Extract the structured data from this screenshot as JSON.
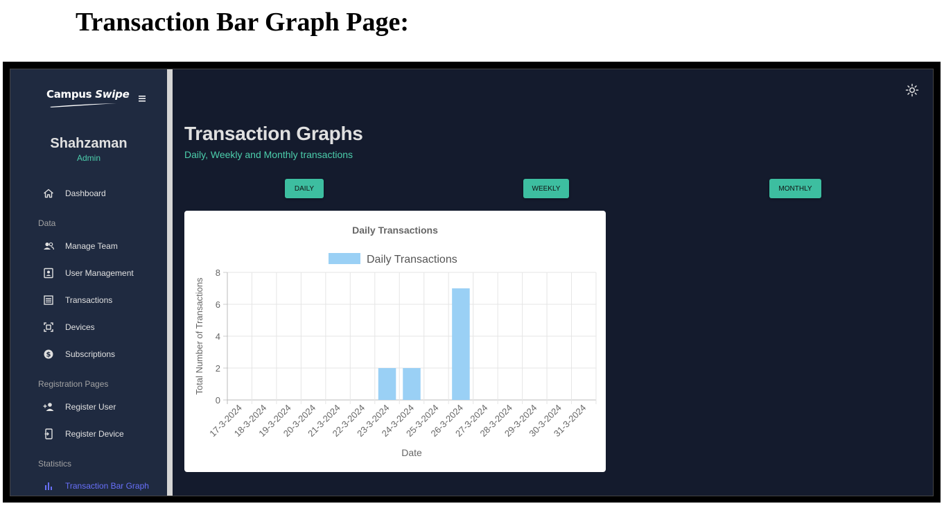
{
  "page": {
    "heading": "Transaction Bar Graph Page:"
  },
  "app": {
    "logo": {
      "text1": "Campus ",
      "text2": "Swipe"
    },
    "profile": {
      "name": "Shahzaman",
      "role": "Admin"
    },
    "sidebar": {
      "dashboard": "Dashboard",
      "sections": [
        {
          "title": "Data",
          "items": [
            "Manage Team",
            "User Management",
            "Transactions",
            "Devices",
            "Subscriptions"
          ]
        },
        {
          "title": "Registration Pages",
          "items": [
            "Register User",
            "Register Device"
          ]
        },
        {
          "title": "Statistics",
          "items": [
            "Transaction Bar Graph"
          ]
        }
      ]
    },
    "main": {
      "title": "Transaction Graphs",
      "subtitle": "Daily, Weekly and Monthly transactions",
      "buttons": {
        "daily": "DAILY",
        "weekly": "WEEKLY",
        "monthly": "MONTHLY"
      }
    },
    "colors": {
      "accent": "#4cceac",
      "active": "#6870fa",
      "bar": "#9ad0f5"
    }
  },
  "chart_data": {
    "type": "bar",
    "title": "Daily Transactions",
    "legend": "Daily Transactions",
    "legend_position": "top",
    "xlabel": "Date",
    "ylabel": "Total Number of Transactions",
    "ylim": [
      0,
      8
    ],
    "yticks": [
      0,
      2,
      4,
      6,
      8
    ],
    "grid": true,
    "categories": [
      "17-3-2024",
      "18-3-2024",
      "19-3-2024",
      "20-3-2024",
      "21-3-2024",
      "22-3-2024",
      "23-3-2024",
      "24-3-2024",
      "25-3-2024",
      "26-3-2024",
      "27-3-2024",
      "28-3-2024",
      "29-3-2024",
      "30-3-2024",
      "31-3-2024"
    ],
    "values": [
      0,
      0,
      0,
      0,
      0,
      0,
      2,
      2,
      0,
      7,
      0,
      0,
      0,
      0,
      0
    ]
  }
}
